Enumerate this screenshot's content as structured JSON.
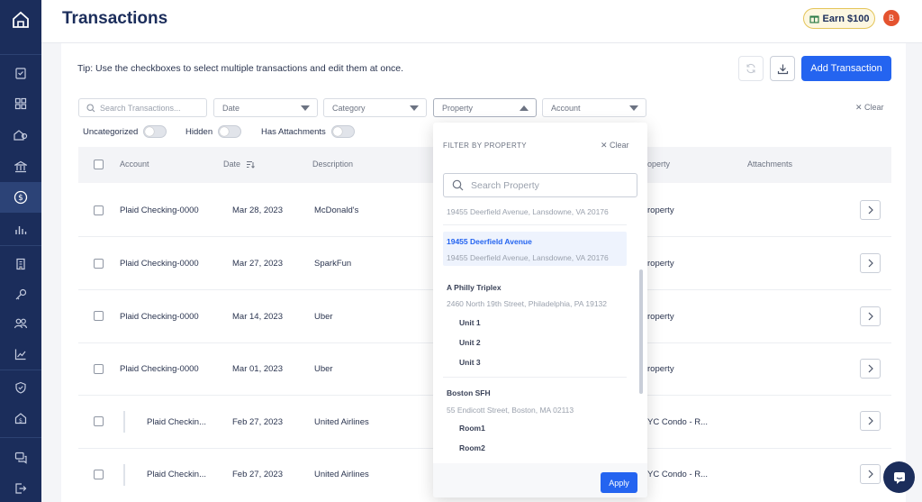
{
  "header": {
    "title": "Transactions",
    "earn_label": "Earn $100",
    "avatar_initial": "B"
  },
  "toolbar": {
    "tip": "Tip: Use the checkboxes to select multiple transactions and edit them at once.",
    "add_label": "Add Transaction"
  },
  "filters": {
    "search_placeholder": "Search Transactions...",
    "date": "Date",
    "category": "Category",
    "property": "Property",
    "account": "Account",
    "clear": "✕ Clear",
    "toggles": [
      "Uncategorized",
      "Hidden",
      "Has Attachments"
    ]
  },
  "table": {
    "headers": {
      "account": "Account",
      "date": "Date",
      "description": "Description",
      "property": "operty",
      "attachments": "Attachments"
    },
    "rows": [
      {
        "account": "Plaid Checking-0000",
        "date": "Mar 28, 2023",
        "description": "McDonald's",
        "property": "roperty"
      },
      {
        "account": "Plaid Checking-0000",
        "date": "Mar 27, 2023",
        "description": "SparkFun",
        "property": "roperty"
      },
      {
        "account": "Plaid Checking-0000",
        "date": "Mar 14, 2023",
        "description": "Uber",
        "property": "roperty"
      },
      {
        "account": "Plaid Checking-0000",
        "date": "Mar 01, 2023",
        "description": "Uber",
        "property": "roperty"
      },
      {
        "account": "Plaid Checkin...",
        "date": "Feb 27, 2023",
        "description": "United Airlines",
        "property": "YC Condo - R..."
      },
      {
        "account": "Plaid Checkin...",
        "date": "Feb 27, 2023",
        "description": "United Airlines",
        "property": "YC Condo - R..."
      }
    ]
  },
  "dropdown": {
    "heading": "FILTER BY PROPERTY",
    "clear": "✕ Clear",
    "search_placeholder": "Search Property",
    "partial_address": "19455 Deerfield Avenue, Lansdowne, VA 20176",
    "selected": {
      "name": "19455 Deerfield Avenue",
      "address": "19455 Deerfield Avenue, Lansdowne, VA 20176"
    },
    "groups": [
      {
        "name": "A Philly Triplex",
        "address": "2460 North 19th Street, Philadelphia, PA 19132",
        "units": [
          "Unit 1",
          "Unit 2",
          "Unit 3"
        ]
      },
      {
        "name": "Boston SFH",
        "address": "55 Endicott Street, Boston, MA 02113",
        "units": [
          "Room1",
          "Room2"
        ]
      }
    ],
    "apply_label": "Apply"
  },
  "colors": {
    "sidebar": "#1b2d5b",
    "accent": "#2464f0",
    "avatar": "#e4532f",
    "selected_bg": "#eef3fd"
  }
}
